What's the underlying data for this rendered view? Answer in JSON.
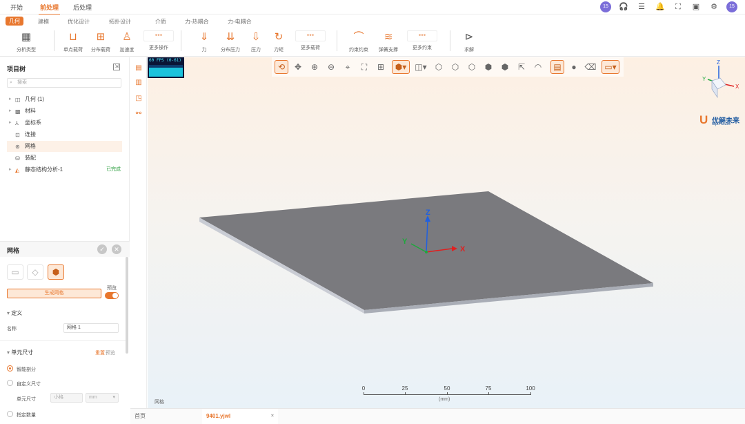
{
  "top_tabs": [
    "开始",
    "前处理",
    "后处理"
  ],
  "top_active": "前处理",
  "user_badge": "15",
  "user_badge_right": "15",
  "sub_tabs": [
    "几何",
    "建模",
    "优化设计",
    "拓扑设计",
    "介质",
    "力-热耦合",
    "力-电耦合"
  ],
  "sub_active": "几何",
  "toolbar": {
    "analysis_type": "分析类型",
    "point_load": "单点载荷",
    "dist_load": "分布载荷",
    "accel": "加速度",
    "more_ops": "更多操作",
    "force": "力",
    "dist_force": "分布压力",
    "pressure": "压力",
    "moment": "力矩",
    "more_load": "更多载荷",
    "fixed": "约束约束",
    "spring": "弹簧支撑",
    "more_constraint": "更多约束",
    "solve": "求解"
  },
  "project_tree": {
    "title": "项目树",
    "search_placeholder": "搜索",
    "items": [
      {
        "label": "几何 (1)",
        "icon": "cube-icon",
        "expandable": true
      },
      {
        "label": "材料",
        "icon": "material-icon",
        "expandable": true
      },
      {
        "label": "坐标系",
        "icon": "axes-icon",
        "expandable": true
      },
      {
        "label": "连接",
        "icon": "connection-icon",
        "expandable": false
      },
      {
        "label": "网格",
        "icon": "mesh-icon",
        "expandable": false,
        "selected": true
      },
      {
        "label": "装配",
        "icon": "assembly-icon",
        "expandable": false
      },
      {
        "label": "静态结构分析-1",
        "icon": "analysis-icon",
        "expandable": true,
        "status": "已完成"
      }
    ]
  },
  "mesh_panel": {
    "title": "网格",
    "generate_button": "生成网格",
    "toggle_label": "预览",
    "section_define": "定义",
    "name_label": "名称",
    "name_value": "网格 1",
    "section_element_size": "单元尺寸",
    "link_reset": "重置",
    "link_preview": "预览",
    "radio_smart": "智能剖分",
    "radio_custom": "自定义尺寸",
    "element_size_label": "单元尺寸",
    "element_size_placeholder": "小格",
    "unit": "mm",
    "radio_count": "指定数量"
  },
  "viewport": {
    "fps_text": "60 FPS (0-61)",
    "view_name": "网格",
    "axis_x": "X",
    "axis_y": "Y",
    "axis_z": "Z",
    "scale_ticks": [
      "0",
      "25",
      "50",
      "75",
      "100"
    ],
    "scale_unit": "(mm)",
    "logo_name": "优解未来",
    "logo_sub": "OptFuture"
  },
  "file_tabs": [
    {
      "label": "首页",
      "active": false
    },
    {
      "label": "9401.yjwl",
      "active": true,
      "close": "×"
    }
  ],
  "colors": {
    "accent": "#e8772e",
    "axis_x": "#e02020",
    "axis_y": "#1ea83c",
    "axis_z": "#2060e0",
    "plate": "#7a7a7e"
  }
}
